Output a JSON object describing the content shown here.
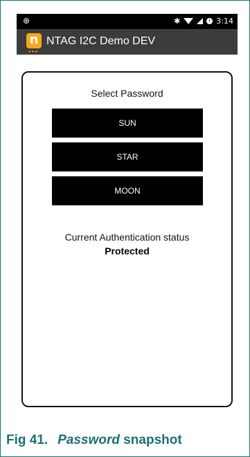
{
  "status_bar": {
    "left_icon": "android-debug-icon",
    "right_icons": [
      "bluetooth-icon",
      "wifi-icon",
      "signal-icon",
      "clock-icon"
    ],
    "time": "3:14"
  },
  "action_bar": {
    "app_icon_letter": "n",
    "title": "NTAG I2C Demo DEV"
  },
  "main": {
    "select_label": "Select Password",
    "buttons": [
      {
        "label": "SUN"
      },
      {
        "label": "STAR"
      },
      {
        "label": "MOON"
      }
    ],
    "auth_label": "Current Authentication status",
    "auth_status": "Protected"
  },
  "caption": {
    "figure": "Fig 41.",
    "italic": "Password",
    "rest": " snapshot"
  },
  "colors": {
    "caption": "#1f6f6f",
    "action_bar": "#3c3c3c",
    "app_icon": "#f6a81c",
    "button": "#000000"
  }
}
